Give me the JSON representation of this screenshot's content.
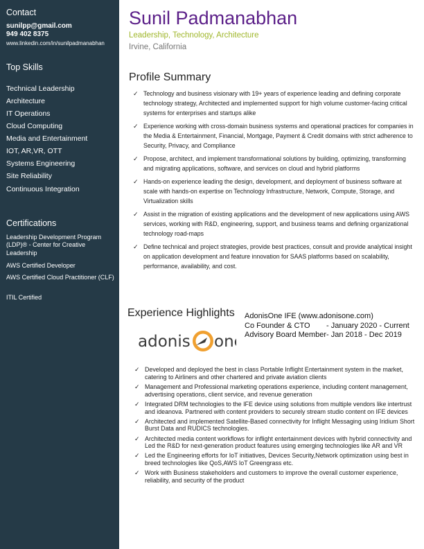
{
  "sidebar": {
    "contact_heading": "Contact",
    "email": "sunilpp@gmail.com",
    "phone": "949 402 8375",
    "linkedin": "www.linkedin.com/in/sunilpadmanabhan",
    "skills_heading": "Top Skills",
    "skills": [
      "Technical Leadership",
      "Architecture",
      "IT Operations",
      "Cloud Computing",
      "Media and Entertainment",
      "IOT, AR,VR, OTT",
      "Systems Engineering",
      "Site Reliability",
      "Continuous Integration"
    ],
    "certifications_heading": "Certifications",
    "certifications": [
      "Leadership Development Program (LDP)® - Center for Creative Leadership",
      "AWS Certified Developer",
      "AWS Certified Cloud Practitioner (CLF)",
      "ITIL Certified"
    ]
  },
  "header": {
    "name": "Sunil Padmanabhan",
    "tagline": "Leadership, Technology, Architecture",
    "location": "Irvine, California"
  },
  "summary": {
    "title": "Profile Summary",
    "items": [
      "Technology and business visionary with 19+ years of experience leading and defining corporate technology strategy, Architected and implemented support for high volume customer-facing critical systems for enterprises and startups alike",
      "Experience working with cross-domain business systems and operational practices for companies in the Media & Entertainment, Financial, Mortgage, Payment & Credit domains with strict adherence to Security, Privacy, and Compliance",
      "Propose, architect, and implement transformational solutions by building, optimizing, transforming and migrating applications, software, and services on cloud and hybrid platforms",
      "Hands-on experience leading the design, development, and deployment of business software at scale with  hands-on expertise on Technology Infrastructure, Network, Compute, Storage, and Virtualization skills",
      "Assist in the migration of existing applications and the development of new applications using AWS services, working with R&D, engineering, support, and business teams and defining organizational technology road-maps",
      "Define technical and project strategies, provide best practices, consult and provide analytical insight on application development and feature innovation for SAAS platforms based on scalability, performance, availability, and cost."
    ]
  },
  "experience": {
    "title": "Experience Highlights",
    "logo_left": "adonis",
    "logo_right": "one",
    "company": "AdonisOne IFE (www.adonisone.com)",
    "role1": "Co Founder & CTO",
    "period1": "- January 2020 - Current",
    "role2": "Advisory Board Member",
    "period2": " - Jan 2018 - Dec 2019",
    "items": [
      "Developed and deployed the best in class Portable Inflight Entertainment system  in the market, catering to Airliners and other chartered and private aviation clients",
      "Management and Professional marketing operations experience, including content management, advertising operations, client service, and revenue generation",
      "Integrated DRM technologies to the IFE device using solutions from multiple vendors like intertrust and ideanova. Partnered with content providers to securely stream studio content on IFE devices",
      "Architected and implemented Satellite-Based connectivity for  Inflight Messaging using Iridium Short Burst Data and  RUDICS technologies.",
      "Architected media content workflows for inflight entertainment devices with hybrid connectivity and Led the R&D for next-generation product features using emerging technologies like AR and VR",
      "Led the Engineering efforts for IoT initiatives, Devices Security,Network optimization using best in breed technologies like QoS,AWS IoT Greengrass etc.",
      "Work with Business stakeholders and customers to improve the overall customer experience, reliability, and  security of the product"
    ]
  },
  "colors": {
    "sidebar_bg": "#253a47",
    "name": "#5b1f88",
    "tagline": "#9fb62a",
    "logo_accent": "#f0a030"
  },
  "icons": {
    "bullet": "check-icon"
  }
}
